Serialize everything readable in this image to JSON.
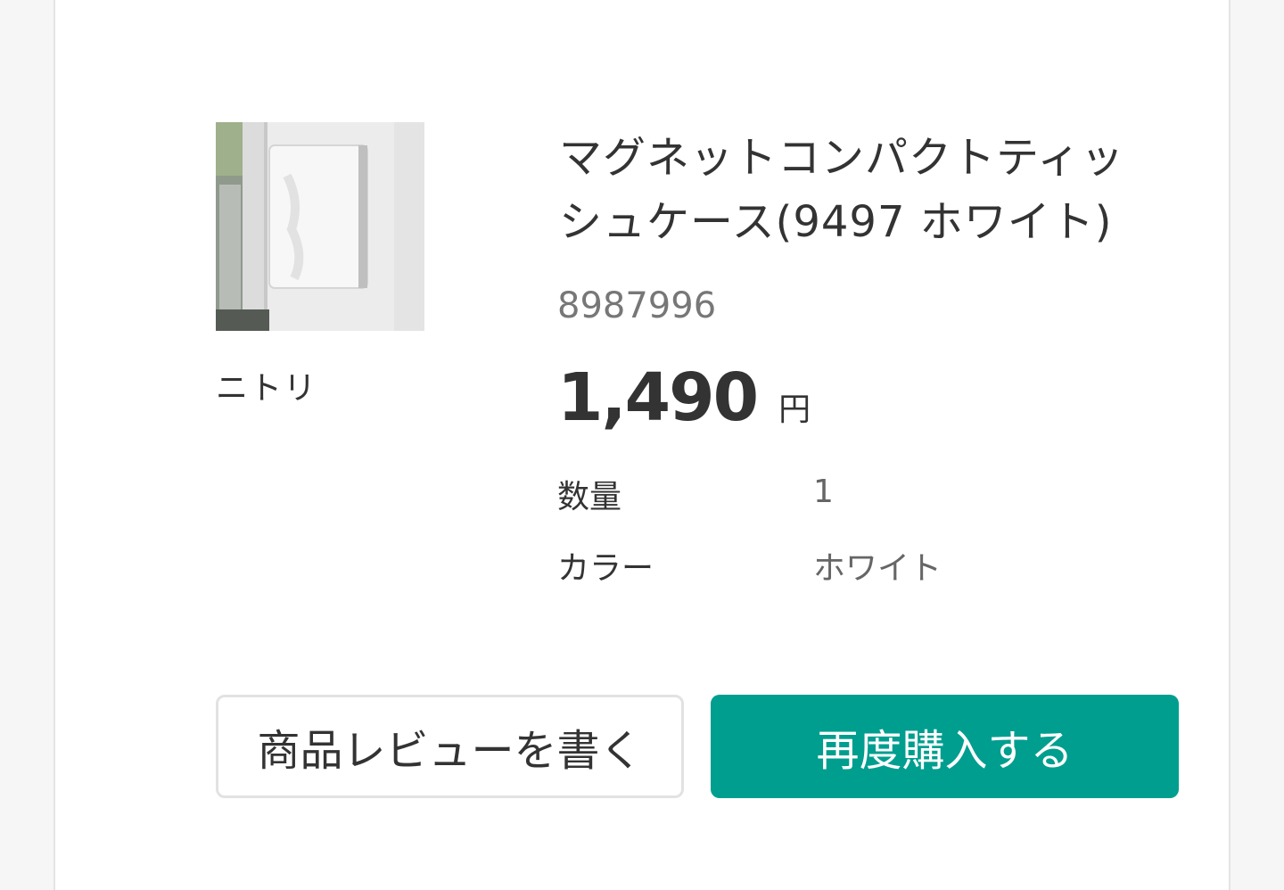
{
  "product": {
    "image_alt": "マグネットコンパクトティッシュケース",
    "brand": "ニトリ",
    "title": "マグネットコンパクトティッシュケース(9497 ホワイト)",
    "code": "8987996",
    "price": "1,490",
    "currency_label": "円"
  },
  "attributes": [
    {
      "label": "数量",
      "value": "1"
    },
    {
      "label": "カラー",
      "value": "ホワイト"
    }
  ],
  "actions": {
    "review_label": "商品レビューを書く",
    "rebuy_label": "再度購入する"
  },
  "colors": {
    "accent": "#009e8f",
    "text": "#333333",
    "muted": "#777777"
  }
}
